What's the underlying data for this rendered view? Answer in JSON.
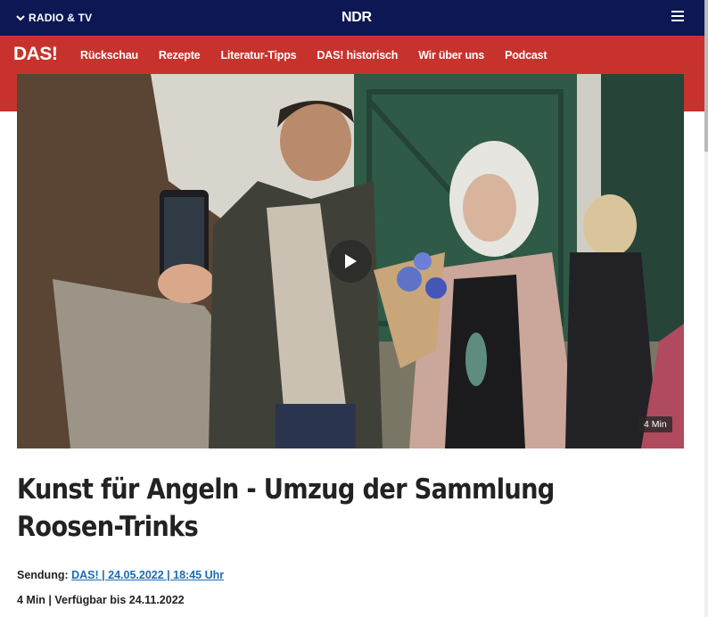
{
  "topbar": {
    "radio_tv_label": "RADIO & TV",
    "logo_text": "NDR",
    "menu_icon": "hamburger-menu-icon",
    "background": "#0c1754"
  },
  "navbar": {
    "logo_text": "DAS!",
    "background": "#c8322c",
    "items": [
      {
        "label": "Rückschau"
      },
      {
        "label": "Rezepte"
      },
      {
        "label": "Literatur-Tipps"
      },
      {
        "label": "DAS! historisch"
      },
      {
        "label": "Wir über uns"
      },
      {
        "label": "Podcast"
      }
    ]
  },
  "video": {
    "duration": "4 Min",
    "play_icon": "play-icon"
  },
  "article": {
    "title": "Kunst für Angeln - Umzug der Sammlung Roosen-Trinks",
    "sendung_label": "Sendung:",
    "sendung_link": "DAS! | 24.05.2022 | 18:45 Uhr",
    "meta": "4 Min | Verfügbar bis 24.11.2022",
    "link_color": "#1c6bb5"
  }
}
